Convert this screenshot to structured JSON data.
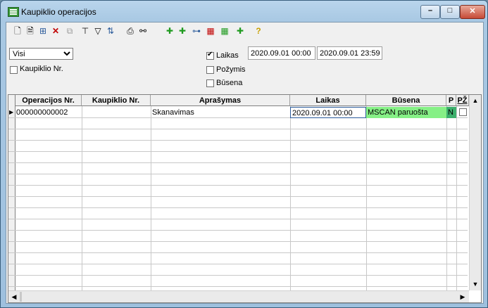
{
  "window": {
    "title": "Kaupiklio operacijos",
    "minimize": "–",
    "maximize": "□",
    "close": "✕"
  },
  "toolbar": {
    "groups": [
      {
        "icon": "new-document-icon",
        "glyph": "🗋"
      },
      {
        "icon": "document-icon",
        "glyph": "🗎"
      },
      {
        "icon": "tree-icon",
        "glyph": "⊞"
      },
      {
        "icon": "delete-icon",
        "glyph": "✕"
      },
      {
        "icon": "copy-icon",
        "glyph": "⧉"
      },
      {
        "icon": "hierarchy-icon",
        "glyph": "⊤"
      },
      {
        "icon": "filter-icon",
        "glyph": "▽"
      },
      {
        "icon": "sort-az-icon",
        "glyph": "⇅"
      },
      {
        "icon": "print-icon",
        "glyph": "⎙"
      },
      {
        "icon": "binoculars-icon",
        "glyph": "⚯"
      },
      {
        "icon": "green-plus-icon",
        "glyph": "✚"
      },
      {
        "icon": "green-plus-2-icon",
        "glyph": "✚"
      },
      {
        "icon": "network-icon",
        "glyph": "⊶"
      },
      {
        "icon": "red-blocks-icon",
        "glyph": "▦"
      },
      {
        "icon": "green-blocks-icon",
        "glyph": "▦"
      },
      {
        "icon": "green-plus-3-icon",
        "glyph": "✚"
      },
      {
        "icon": "help-icon",
        "glyph": "?"
      }
    ]
  },
  "filter": {
    "selected": "Visi",
    "options": [
      "Visi"
    ]
  },
  "checkboxes": {
    "kaupiklio_nr": {
      "label": "Kaupiklio Nr.",
      "checked": false
    },
    "laikas": {
      "label": "Laikas",
      "checked": true
    },
    "pozymis": {
      "label": "Požymis",
      "checked": false
    },
    "busena": {
      "label": "Būsena",
      "checked": false
    }
  },
  "dates": {
    "from": "2020.09.01 00:00",
    "to": "2020.09.01 23:59"
  },
  "grid": {
    "columns": [
      "Operacijos Nr.",
      "Kaupiklio Nr.",
      "Aprašymas",
      "Laikas",
      "Būsena",
      "P",
      "PŽ"
    ],
    "rows": [
      {
        "operacijos_nr": "000000000002",
        "kaupiklio_nr": "",
        "aprasymas": "Skanavimas",
        "laikas": "2020.09.01 00:00",
        "busena": "MSCAN paruošta",
        "p": "N",
        "pz": false
      }
    ],
    "status_color": "#86f086"
  }
}
